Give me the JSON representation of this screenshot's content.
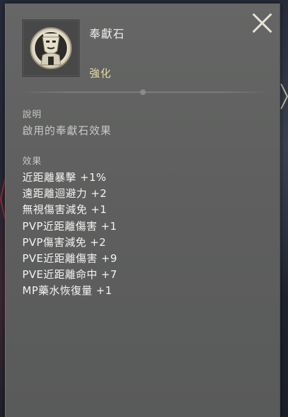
{
  "item": {
    "name": "奉獻石",
    "type": "強化",
    "icon": "masked-helmet-emblem-icon"
  },
  "description": {
    "label": "說明",
    "text": "啟用的奉獻石效果"
  },
  "effects": {
    "label": "效果",
    "items": [
      "近距離暴擊 +1%",
      "遠距離迴避力 +2",
      "無視傷害減免 +1",
      "PVP近距離傷害 +1",
      "PVP傷害減免 +2",
      "PVE近距離傷害 +9",
      "PVE近距離命中 +7",
      "MP藥水恢復量 +1"
    ]
  },
  "colors": {
    "panel": "#5f605f",
    "item_type": "#e7d9a5",
    "text": "#f5f5f2",
    "close_icon": "#e6e0cf"
  }
}
